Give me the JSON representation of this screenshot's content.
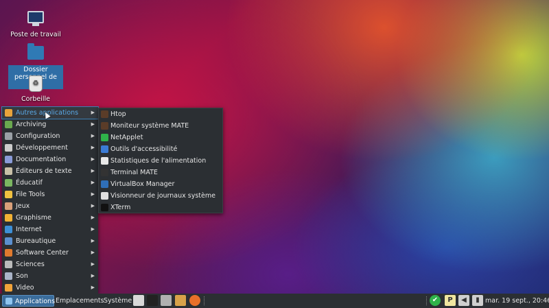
{
  "desktop": {
    "icons": [
      {
        "label": "Poste de travail",
        "icon": "computer-icon"
      },
      {
        "label": "Dossier personnel de eric",
        "icon": "home-folder-icon"
      },
      {
        "label": "Corbeille",
        "icon": "trash-icon"
      }
    ]
  },
  "main_menu": {
    "items": [
      {
        "label": "Autres applications",
        "icon": "other-apps-icon",
        "color": "#e8a33b"
      },
      {
        "label": "Archiving",
        "icon": "archive-icon",
        "color": "#6aa84f"
      },
      {
        "label": "Configuration",
        "icon": "settings-icon",
        "color": "#9aa0a6"
      },
      {
        "label": "Développement",
        "icon": "development-icon",
        "color": "#cccccc"
      },
      {
        "label": "Documentation",
        "icon": "documentation-icon",
        "color": "#8a9bd8"
      },
      {
        "label": "Éditeurs de texte",
        "icon": "text-editor-icon",
        "color": "#c9c0a8"
      },
      {
        "label": "Éducatif",
        "icon": "education-icon",
        "color": "#7bb661"
      },
      {
        "label": "File Tools",
        "icon": "file-tools-icon",
        "color": "#f0c040"
      },
      {
        "label": "Jeux",
        "icon": "games-icon",
        "color": "#d9a07a"
      },
      {
        "label": "Graphisme",
        "icon": "graphics-icon",
        "color": "#f2b134"
      },
      {
        "label": "Internet",
        "icon": "internet-icon",
        "color": "#3d8fd6"
      },
      {
        "label": "Bureautique",
        "icon": "office-icon",
        "color": "#5b8fd0"
      },
      {
        "label": "Software Center",
        "icon": "software-center-icon",
        "color": "#e07a2e"
      },
      {
        "label": "Sciences",
        "icon": "science-icon",
        "color": "#bbbbbb"
      },
      {
        "label": "Son",
        "icon": "sound-icon",
        "color": "#aab4c8"
      },
      {
        "label": "Video",
        "icon": "video-icon",
        "color": "#f2a33a"
      }
    ]
  },
  "sub_menu": {
    "items": [
      {
        "label": "Htop",
        "icon": "htop-icon",
        "color": "#5a3c28"
      },
      {
        "label": "Moniteur système MATE",
        "icon": "system-monitor-icon",
        "color": "#5a3c28"
      },
      {
        "label": "NetApplet",
        "icon": "netapplet-icon",
        "color": "#2fb34a"
      },
      {
        "label": "Outils d'accessibilité",
        "icon": "accessibility-icon",
        "color": "#3b7bd4"
      },
      {
        "label": "Statistiques de l'alimentation",
        "icon": "power-stats-icon",
        "color": "#e8e8e8"
      },
      {
        "label": "Terminal MATE",
        "icon": "terminal-icon",
        "color": "#333333"
      },
      {
        "label": "VirtualBox Manager",
        "icon": "virtualbox-icon",
        "color": "#2f6fb8"
      },
      {
        "label": "Visionneur de journaux système",
        "icon": "log-viewer-icon",
        "color": "#e0e0e0"
      },
      {
        "label": "XTerm",
        "icon": "xterm-icon",
        "color": "#111111"
      }
    ]
  },
  "taskbar": {
    "applications": "Applications",
    "places": "Emplacements",
    "system": "Système",
    "launchers": [
      {
        "icon": "text-editor-icon",
        "color": "#d8d8d8"
      },
      {
        "icon": "terminal-icon",
        "color": "#222222"
      },
      {
        "icon": "settings-icon",
        "color": "#b0b0b0"
      },
      {
        "icon": "package-icon",
        "color": "#d8a24a"
      },
      {
        "icon": "firefox-icon",
        "color": "#e8702a"
      }
    ],
    "tray": [
      {
        "icon": "network-icon",
        "color": "#2fb34a",
        "glyph": "✔"
      },
      {
        "icon": "keyboard-layout-icon",
        "color": "#f0e6a0",
        "glyph": "P"
      },
      {
        "icon": "volume-icon",
        "color": "#cfcfcf",
        "glyph": "◀"
      },
      {
        "icon": "battery-icon",
        "color": "#cfcfcf",
        "glyph": "▮"
      }
    ],
    "clock": "mar. 19 sept., 20:46"
  },
  "colors": {
    "menu_bg": "#2b2f33",
    "highlight": "#5aa9e6",
    "selection": "#2f6ea6"
  }
}
